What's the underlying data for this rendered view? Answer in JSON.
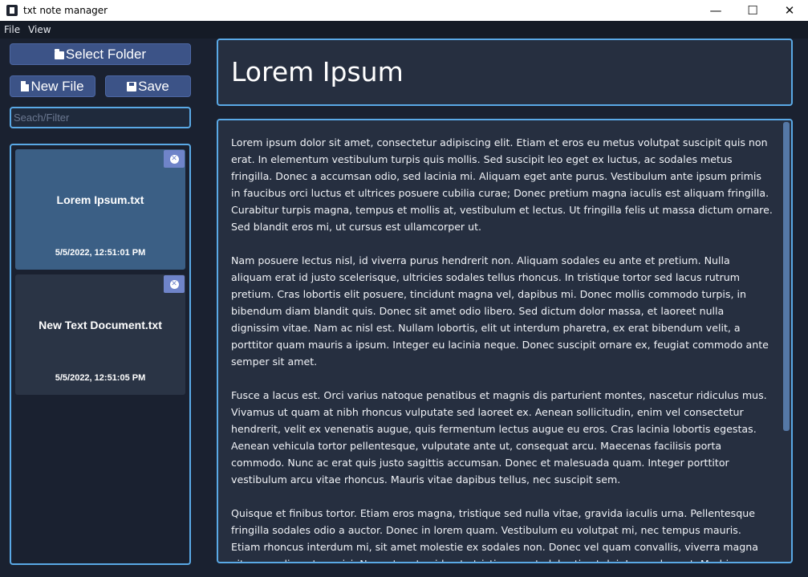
{
  "window": {
    "title": "txt note manager",
    "minimize": "—",
    "maximize": "☐",
    "close": "✕"
  },
  "menu": {
    "file": "File",
    "view": "View"
  },
  "sidebar": {
    "select_folder": "Select Folder",
    "new_file": "New File",
    "save": "Save",
    "search_placeholder": "Seach/Filter",
    "files": [
      {
        "name": "Lorem Ipsum.txt",
        "date": "5/5/2022, 12:51:01 PM",
        "close": "✕"
      },
      {
        "name": "New Text Document.txt",
        "date": "5/5/2022, 12:51:05 PM",
        "close": "✕"
      }
    ]
  },
  "note": {
    "title": "Lorem Ipsum",
    "paragraphs": [
      "Lorem ipsum dolor sit amet, consectetur adipiscing elit. Etiam et eros eu metus volutpat suscipit quis non erat. In elementum vestibulum turpis quis mollis. Sed suscipit leo eget ex luctus, ac sodales metus fringilla. Donec a accumsan odio, sed lacinia mi. Aliquam eget ante purus. Vestibulum ante ipsum primis in faucibus orci luctus et ultrices posuere cubilia curae; Donec pretium magna iaculis est aliquam fringilla. Curabitur turpis magna, tempus et mollis at, vestibulum et lectus. Ut fringilla felis ut massa dictum ornare. Sed blandit eros mi, ut cursus est ullamcorper ut.",
      "Nam posuere lectus nisl, id viverra purus hendrerit non. Aliquam sodales eu ante et pretium. Nulla aliquam erat id justo scelerisque, ultricies sodales tellus rhoncus. In tristique tortor sed lacus rutrum pretium. Cras lobortis elit posuere, tincidunt magna vel, dapibus mi. Donec mollis commodo turpis, in bibendum diam blandit quis. Donec sit amet odio libero. Sed dictum dolor massa, et laoreet nulla dignissim vitae. Nam ac nisl est. Nullam lobortis, elit ut interdum pharetra, ex erat bibendum velit, a porttitor quam mauris a ipsum. Integer eu lacinia neque. Donec suscipit ornare ex, feugiat commodo ante semper sit amet.",
      "Fusce a lacus est. Orci varius natoque penatibus et magnis dis parturient montes, nascetur ridiculus mus. Vivamus ut quam at nibh rhoncus vulputate sed laoreet ex. Aenean sollicitudin, enim vel consectetur hendrerit, velit ex venenatis augue, quis fermentum lectus augue eu eros. Cras lacinia lobortis egestas. Aenean vehicula tortor pellentesque, vulputate ante ut, consequat arcu. Maecenas facilisis porta commodo. Nunc ac erat quis justo sagittis accumsan. Donec et malesuada quam. Integer porttitor vestibulum arcu vitae rhoncus. Mauris vitae dapibus tellus, nec suscipit sem.",
      "Quisque et finibus tortor. Etiam eros magna, tristique sed nulla vitae, gravida iaculis urna. Pellentesque fringilla sodales odio a auctor. Donec in lorem quam. Vestibulum eu volutpat mi, nec tempus mauris. Etiam rhoncus interdum mi, sit amet molestie ex sodales non. Donec vel quam convallis, viverra magna vitae, condimentum nisi. Nam ut metus id ante tristique porta lobortis ut dui. In non leo est. Morbi"
    ]
  }
}
